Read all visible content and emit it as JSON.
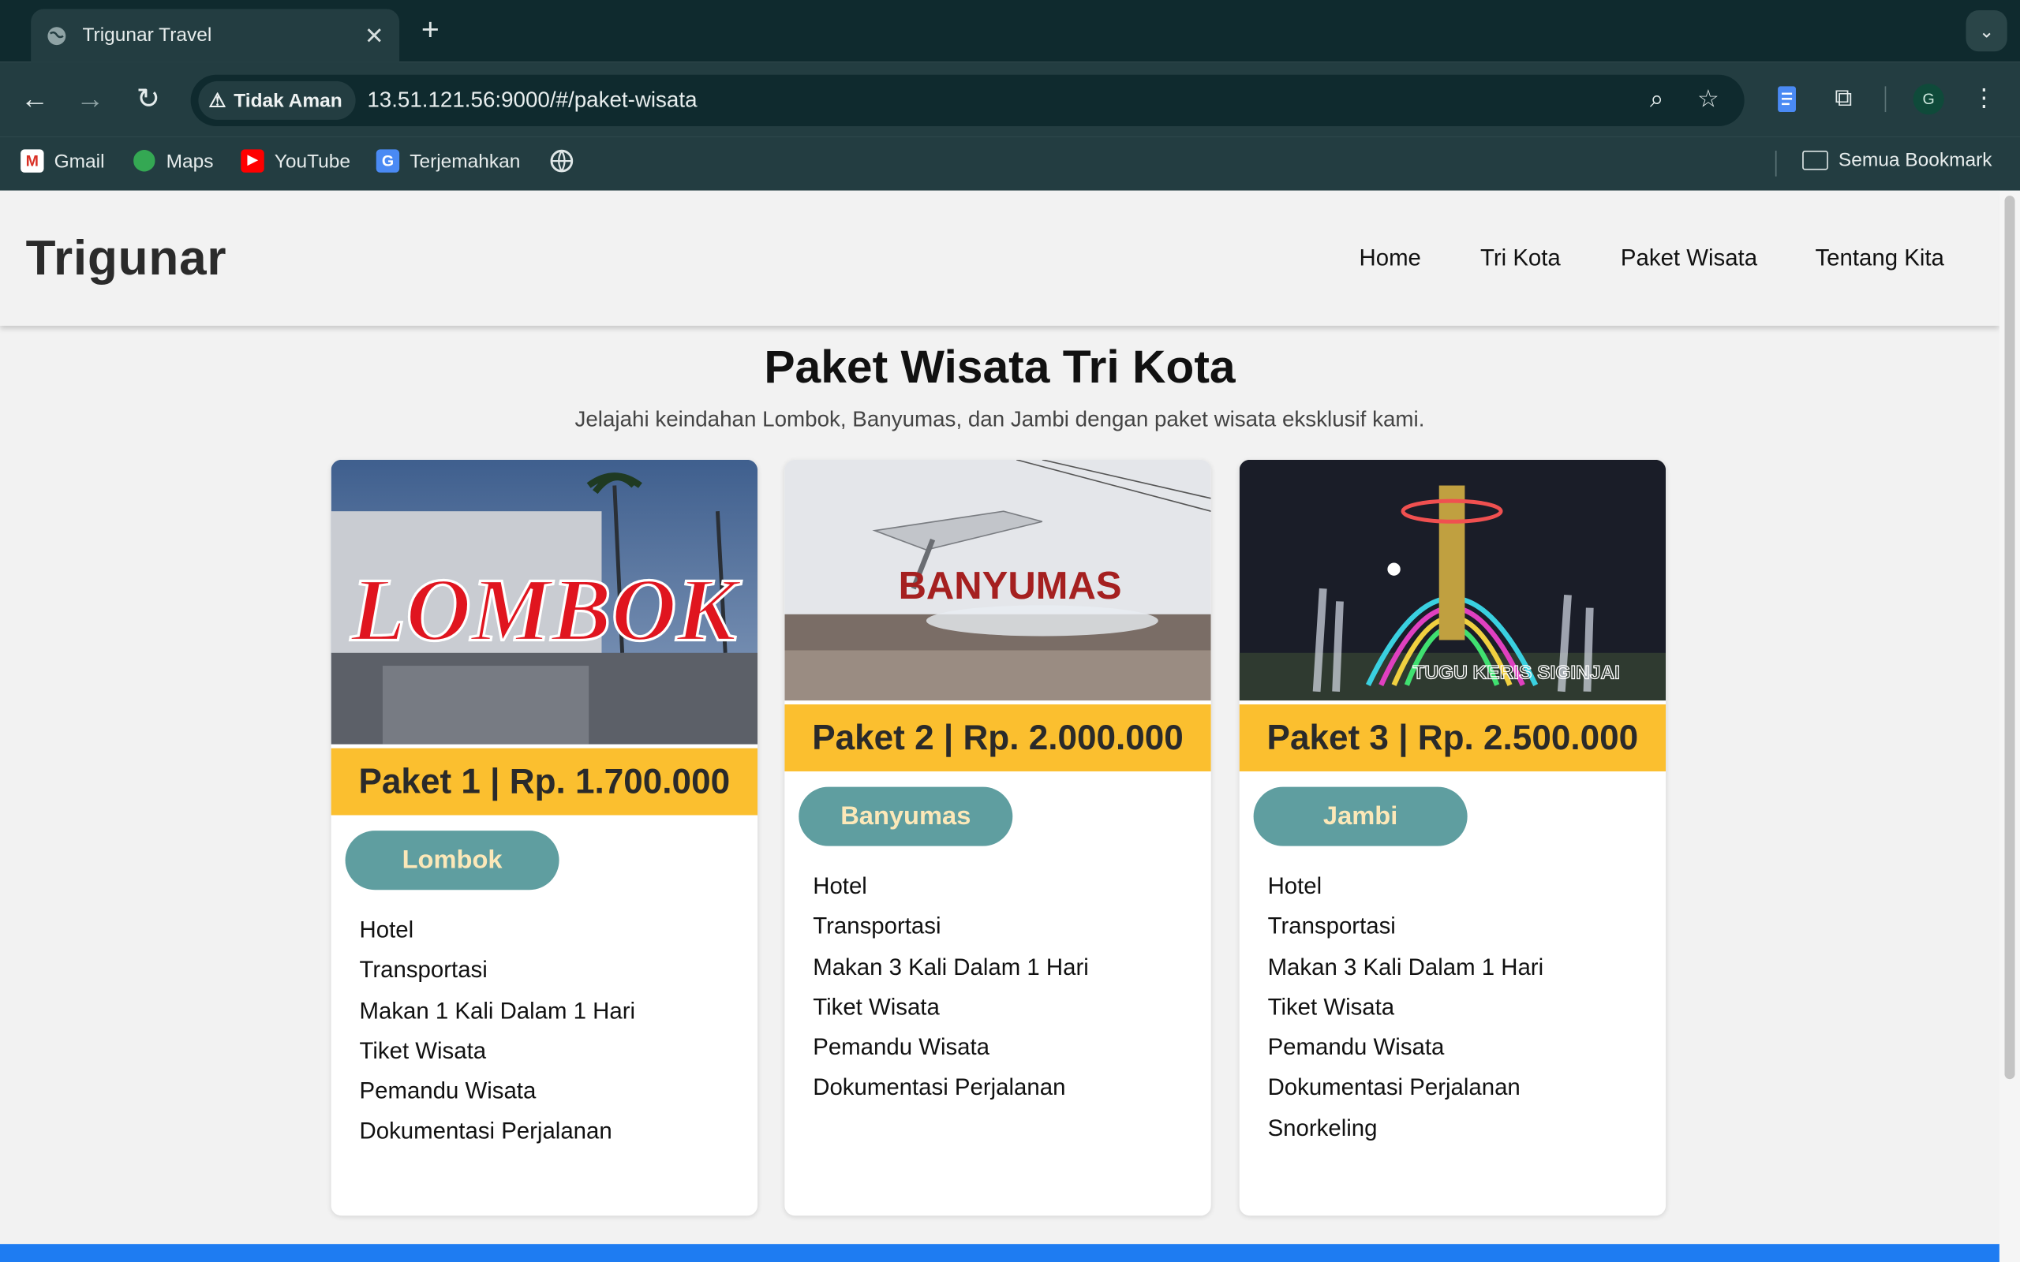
{
  "browser": {
    "tab_title": "Trigunar Travel",
    "security_label": "Tidak Aman",
    "url": "13.51.121.56:9000/#/paket-wisata",
    "profile_initial": "G",
    "bookmarks": [
      {
        "label": "Gmail",
        "icon": "gmail-icon"
      },
      {
        "label": "Maps",
        "icon": "maps-icon"
      },
      {
        "label": "YouTube",
        "icon": "youtube-icon"
      },
      {
        "label": "Terjemahkan",
        "icon": "translate-icon"
      }
    ],
    "all_bookmarks_label": "Semua Bookmark"
  },
  "site": {
    "brand": "Trigunar",
    "nav": [
      "Home",
      "Tri Kota",
      "Paket Wisata",
      "Tentang Kita"
    ]
  },
  "main": {
    "title": "Paket Wisata Tri Kota",
    "subtitle": "Jelajahi keindahan Lombok, Banyumas, dan Jambi dengan paket wisata eksklusif kami.",
    "packages": [
      {
        "price_label": "Paket 1 | Rp. 1.700.000",
        "city": "Lombok",
        "image_text": "LOMBOK",
        "features": [
          "Hotel",
          "Transportasi",
          "Makan 1 Kali Dalam 1 Hari",
          "Tiket Wisata",
          "Pemandu Wisata",
          "Dokumentasi Perjalanan"
        ]
      },
      {
        "price_label": "Paket 2 | Rp. 2.000.000",
        "city": "Banyumas",
        "image_text": "BANYUMAS",
        "features": [
          "Hotel",
          "Transportasi",
          "Makan 3 Kali Dalam 1 Hari",
          "Tiket Wisata",
          "Pemandu Wisata",
          "Dokumentasi Perjalanan"
        ]
      },
      {
        "price_label": "Paket 3 | Rp. 2.500.000",
        "city": "Jambi",
        "image_text": "TUGU KERIS SIGINJAI",
        "features": [
          "Hotel",
          "Transportasi",
          "Makan 3 Kali Dalam 1 Hari",
          "Tiket Wisata",
          "Pemandu Wisata",
          "Dokumentasi Perjalanan",
          "Snorkeling"
        ]
      }
    ]
  },
  "colors": {
    "price_band": "#fbbf2f",
    "city_button": "#5f9ea0",
    "footer_bar": "#1e7cf2"
  }
}
